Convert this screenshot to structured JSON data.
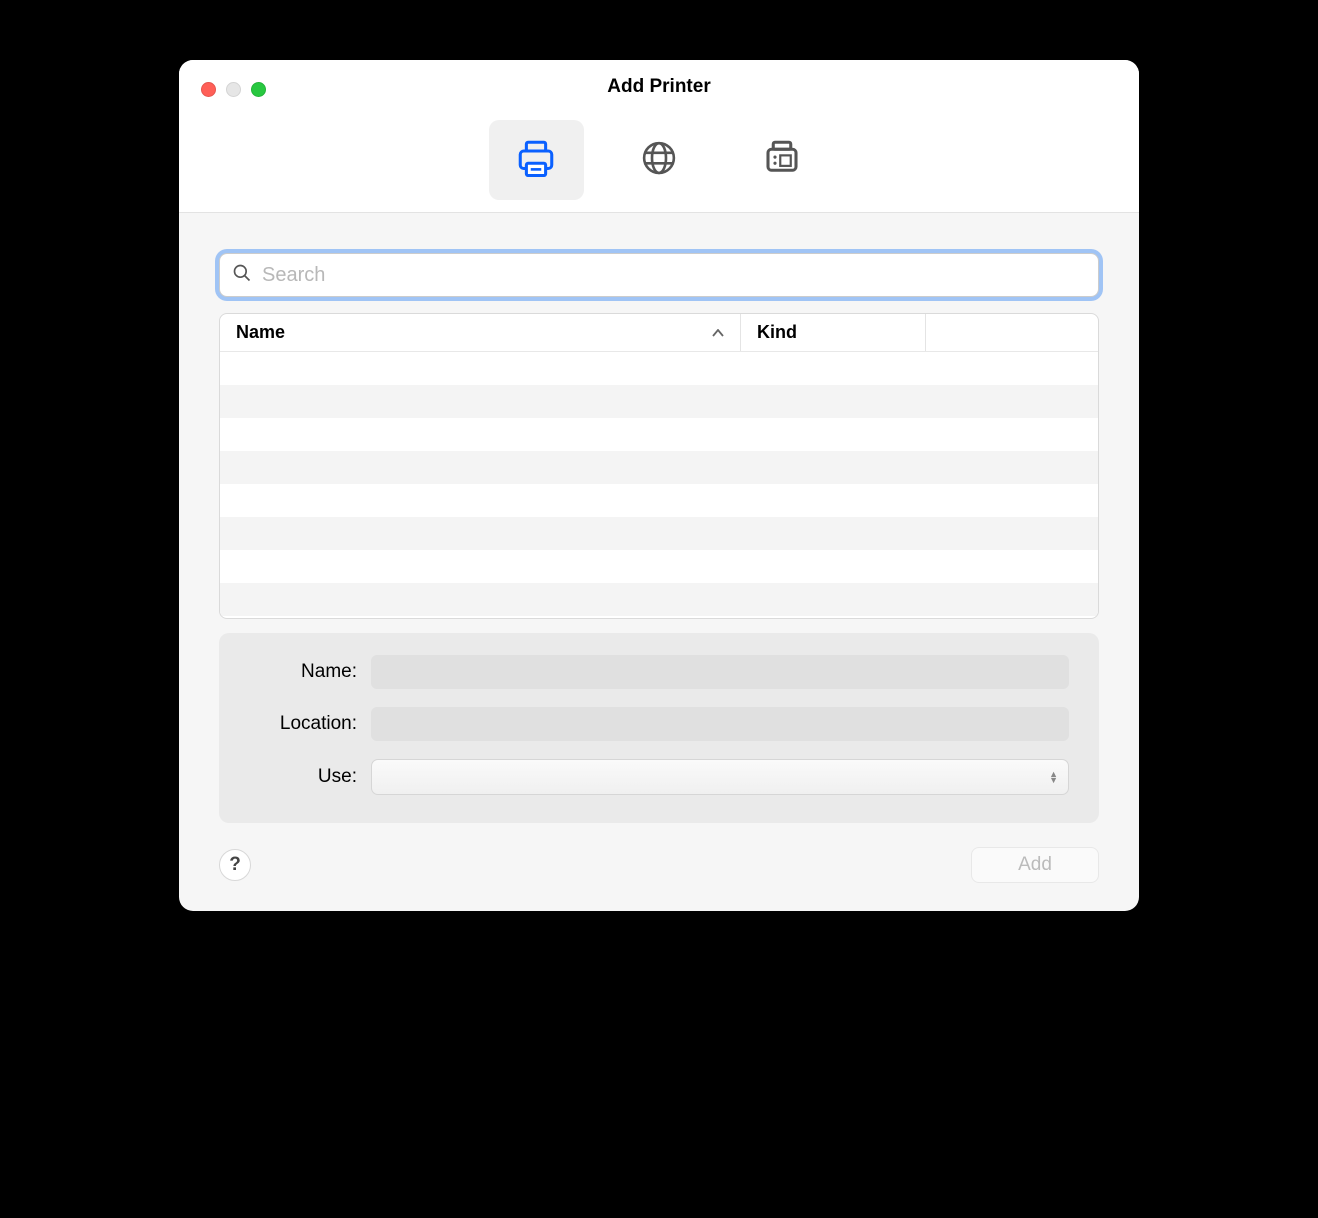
{
  "window": {
    "title": "Add Printer"
  },
  "tabs": [
    {
      "id": "default",
      "active": true
    },
    {
      "id": "ip",
      "active": false
    },
    {
      "id": "windows",
      "active": false
    }
  ],
  "search": {
    "placeholder": "Search",
    "value": ""
  },
  "table": {
    "columns": {
      "name": "Name",
      "kind": "Kind"
    },
    "rows": []
  },
  "form": {
    "name_label": "Name:",
    "name_value": "",
    "location_label": "Location:",
    "location_value": "",
    "use_label": "Use:",
    "use_value": ""
  },
  "footer": {
    "help": "?",
    "add": "Add"
  }
}
